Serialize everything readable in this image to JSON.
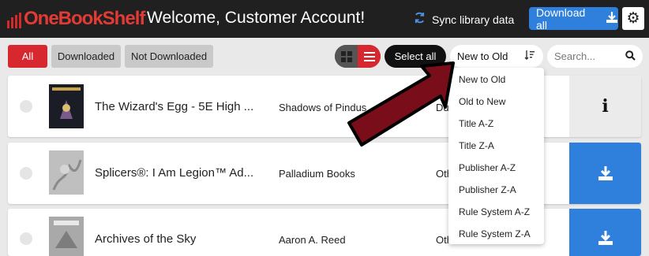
{
  "header": {
    "logo": "OneBookShelf",
    "welcome": "Welcome, Customer Account!",
    "sync_label": "Sync library data",
    "download_all_label": "Download all"
  },
  "filters": {
    "all": "All",
    "downloaded": "Downloaded",
    "not_downloaded": "Not Downloaded"
  },
  "toolbar": {
    "select_all": "Select all",
    "sort_selected": "New to Old",
    "search_placeholder": "Search..."
  },
  "sort_options": [
    "New to Old",
    "Old to New",
    "Title A-Z",
    "Title Z-A",
    "Publisher A-Z",
    "Publisher Z-A",
    "Rule System A-Z",
    "Rule System Z-A"
  ],
  "rows": [
    {
      "title": "The Wizard's Egg - 5E High ...",
      "publisher": "Shadows of Pindus",
      "system": "Du",
      "action": "info-icon"
    },
    {
      "title": "Splicers®: I Am Legion™ Ad...",
      "publisher": "Palladium Books",
      "system": "Oth",
      "action": "download-icon"
    },
    {
      "title": "Archives of the Sky",
      "publisher": "Aaron A. Reed",
      "system": "Oth",
      "action": "download-icon"
    }
  ],
  "colors": {
    "brand_red": "#d8282f",
    "accent_blue": "#2f7fdd",
    "topbar": "#202020",
    "arrow": "#7a0d1a"
  }
}
